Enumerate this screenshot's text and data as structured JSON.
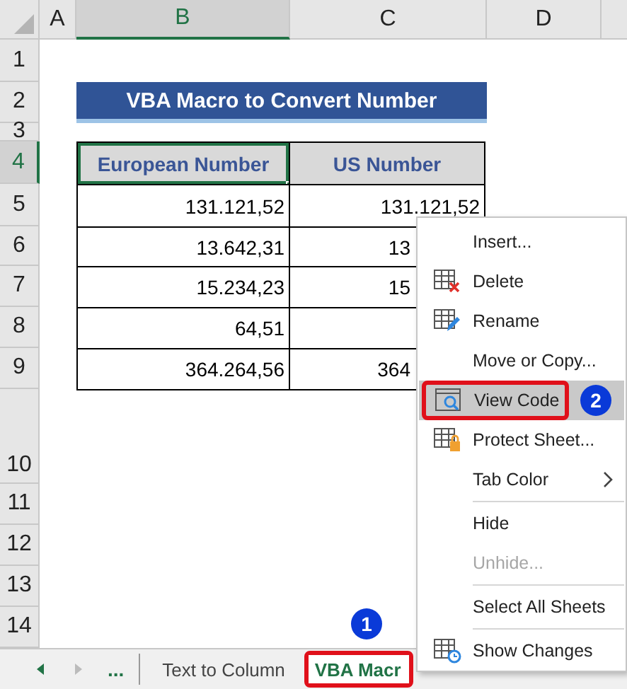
{
  "columns": [
    {
      "label": "A",
      "selected": false
    },
    {
      "label": "B",
      "selected": true
    },
    {
      "label": "C",
      "selected": false
    },
    {
      "label": "D",
      "selected": false
    }
  ],
  "rows": [
    {
      "label": "1",
      "selected": false
    },
    {
      "label": "2",
      "selected": false
    },
    {
      "label": "3",
      "selected": false
    },
    {
      "label": "4",
      "selected": true
    },
    {
      "label": "5",
      "selected": false
    },
    {
      "label": "6",
      "selected": false
    },
    {
      "label": "7",
      "selected": false
    },
    {
      "label": "8",
      "selected": false
    },
    {
      "label": "9",
      "selected": false
    },
    {
      "label": "10",
      "selected": false
    },
    {
      "label": "11",
      "selected": false
    },
    {
      "label": "12",
      "selected": false
    },
    {
      "label": "13",
      "selected": false
    },
    {
      "label": "14",
      "selected": false
    }
  ],
  "title": "VBA Macro to Convert Number",
  "table": {
    "headers": [
      "European Number",
      "US Number"
    ],
    "rows": [
      [
        "131.121,52",
        "131.121,52"
      ],
      [
        "13.642,31",
        "13"
      ],
      [
        "15.234,23",
        "15"
      ],
      [
        "64,51"
      ],
      [
        "364.264,56",
        "364"
      ]
    ]
  },
  "context_menu": [
    {
      "kind": "item",
      "label": "Insert...",
      "selected": false,
      "disabled": false
    },
    {
      "kind": "item",
      "label": "Delete",
      "selected": false,
      "disabled": false
    },
    {
      "kind": "item",
      "label": "Rename",
      "selected": false,
      "disabled": false
    },
    {
      "kind": "item",
      "label": "Move or Copy...",
      "selected": false,
      "disabled": false
    },
    {
      "kind": "item",
      "label": "View Code",
      "selected": true,
      "disabled": false,
      "badge": "2"
    },
    {
      "kind": "item",
      "label": "Protect Sheet...",
      "selected": false,
      "disabled": false
    },
    {
      "kind": "submenu",
      "label": "Tab Color",
      "selected": false,
      "disabled": false
    },
    {
      "kind": "separator"
    },
    {
      "kind": "item",
      "label": "Hide",
      "selected": false,
      "disabled": false
    },
    {
      "kind": "item",
      "label": "Unhide...",
      "selected": false,
      "disabled": true
    },
    {
      "kind": "separator"
    },
    {
      "kind": "item",
      "label": "Select All Sheets",
      "selected": false,
      "disabled": false
    },
    {
      "kind": "separator"
    },
    {
      "kind": "item",
      "label": "Show Changes",
      "selected": false,
      "disabled": false
    }
  ],
  "sheet_tabs": {
    "more": "...",
    "tabs": [
      {
        "label": "Text to Column",
        "selected": false
      },
      {
        "label": "VBA Macr",
        "selected": true,
        "badge": "1"
      }
    ]
  }
}
